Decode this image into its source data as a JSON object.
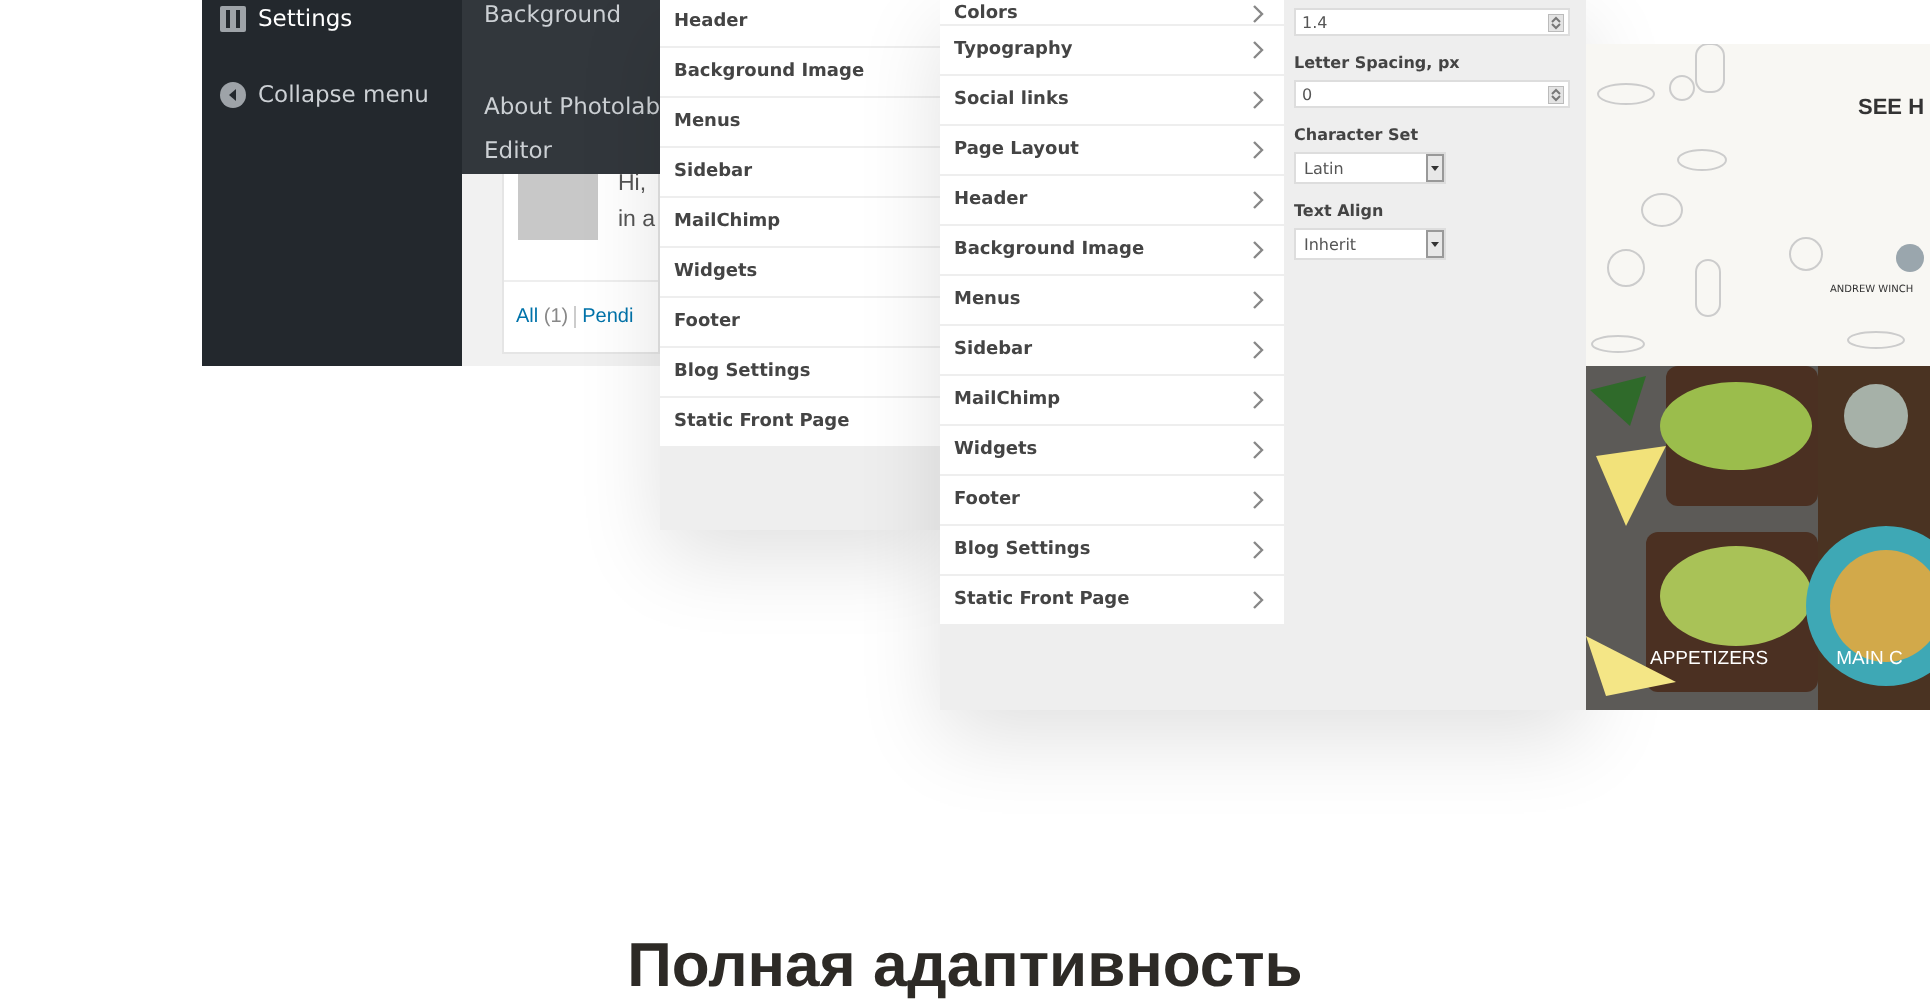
{
  "admin_menu": {
    "items": [
      {
        "kind": "settings",
        "label": "Settings"
      },
      {
        "kind": "collapse",
        "label": "Collapse menu"
      }
    ]
  },
  "submenu": {
    "groups": [
      [
        "Background"
      ],
      [
        "About Photolab",
        "Editor"
      ]
    ]
  },
  "dashboard": {
    "greeting_lines": [
      "Hi,",
      "in a"
    ],
    "filters": [
      {
        "label": "All",
        "count": "(1)"
      },
      {
        "label": "Pendi"
      }
    ]
  },
  "customizer_back": {
    "sections": [
      "Header",
      "Background Image",
      "Menus",
      "Sidebar",
      "MailChimp",
      "Widgets",
      "Footer",
      "Blog Settings",
      "Static Front Page"
    ]
  },
  "customizer_front": {
    "sections": [
      "Colors",
      "Typography",
      "Social links",
      "Page Layout",
      "Header",
      "Background Image",
      "Menus",
      "Sidebar",
      "MailChimp",
      "Widgets",
      "Footer",
      "Blog Settings",
      "Static Front Page"
    ],
    "fields": [
      {
        "kind": "number",
        "value": "1.4"
      },
      {
        "kind": "number",
        "label": "Letter Spacing, px",
        "value": "0"
      },
      {
        "kind": "select",
        "label": "Character Set",
        "value": "Latin"
      },
      {
        "kind": "select",
        "label": "Text Align",
        "value": "Inherit"
      }
    ]
  },
  "site_preview": {
    "heading": "SEE H",
    "author": "ANDREW WINCH",
    "categories": [
      "APPETIZERS",
      "MAIN C"
    ]
  },
  "headline": "Полная адаптивность"
}
